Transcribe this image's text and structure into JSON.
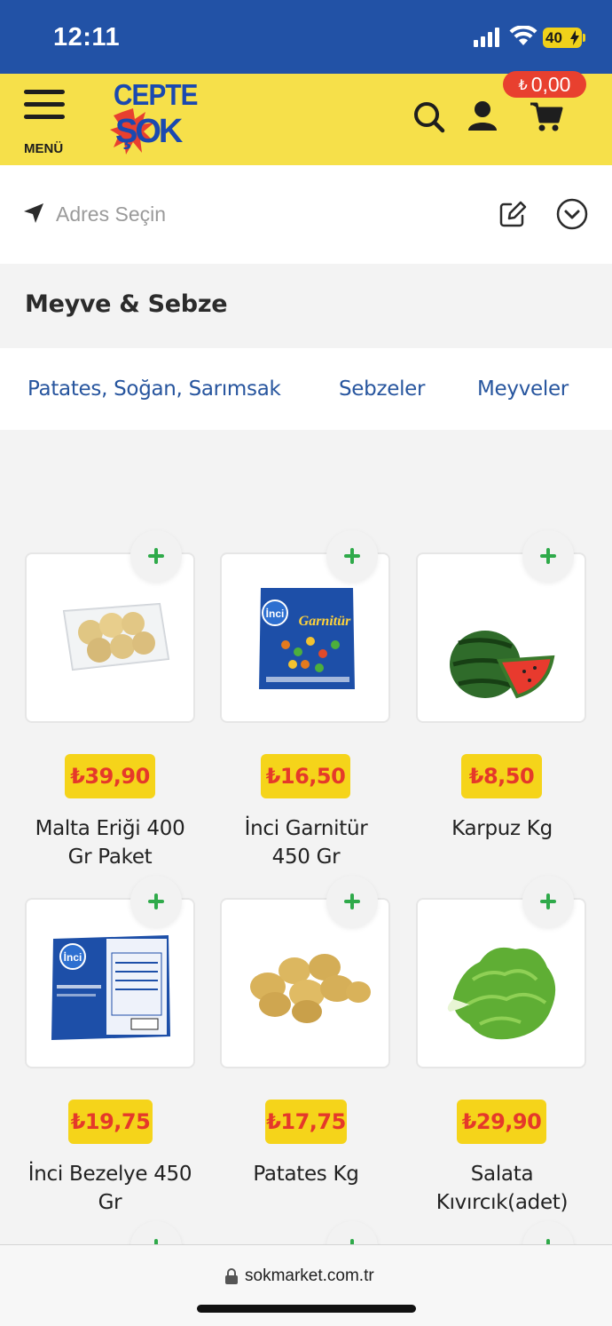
{
  "status_bar": {
    "time": "12:11",
    "battery": "40"
  },
  "header": {
    "menu_label": "MENÜ",
    "logo_top": "CEPTE",
    "logo_bottom": "ŞOK",
    "cart_currency": "₺",
    "cart_total": "0,00"
  },
  "address": {
    "placeholder": "Adres Seçin"
  },
  "category": {
    "title": "Meyve & Sebze"
  },
  "subcategories": [
    "Patates, Soğan, Sarımsak",
    "Sebzeler",
    "Meyveler"
  ],
  "products": [
    {
      "price": "₺39,90",
      "name_line1": "Malta Eriği 400",
      "name_line2": "Gr Paket"
    },
    {
      "price": "₺16,50",
      "name_line1": "İnci Garnitür",
      "name_line2": "450 Gr"
    },
    {
      "price": "₺8,50",
      "name_line1": "Karpuz Kg",
      "name_line2": ""
    },
    {
      "price": "₺19,75",
      "name_line1": "İnci Bezelye 450",
      "name_line2": "Gr"
    },
    {
      "price": "₺17,75",
      "name_line1": "Patates Kg",
      "name_line2": ""
    },
    {
      "price": "₺29,90",
      "name_line1": "Salata",
      "name_line2": "Kıvırcık(adet)"
    }
  ],
  "product_images": {
    "garnitur_brand": "İnci",
    "garnitur_title": "Garnitür",
    "bezelye_brand": "İnci"
  },
  "browser": {
    "url": "sokmarket.com.tr"
  },
  "colors": {
    "status_blue": "#2252a6",
    "header_yellow": "#f6e04a",
    "price_yellow": "#f5d41a",
    "price_red": "#e5392a",
    "link_blue": "#27559e",
    "plus_green": "#2faa4a"
  }
}
